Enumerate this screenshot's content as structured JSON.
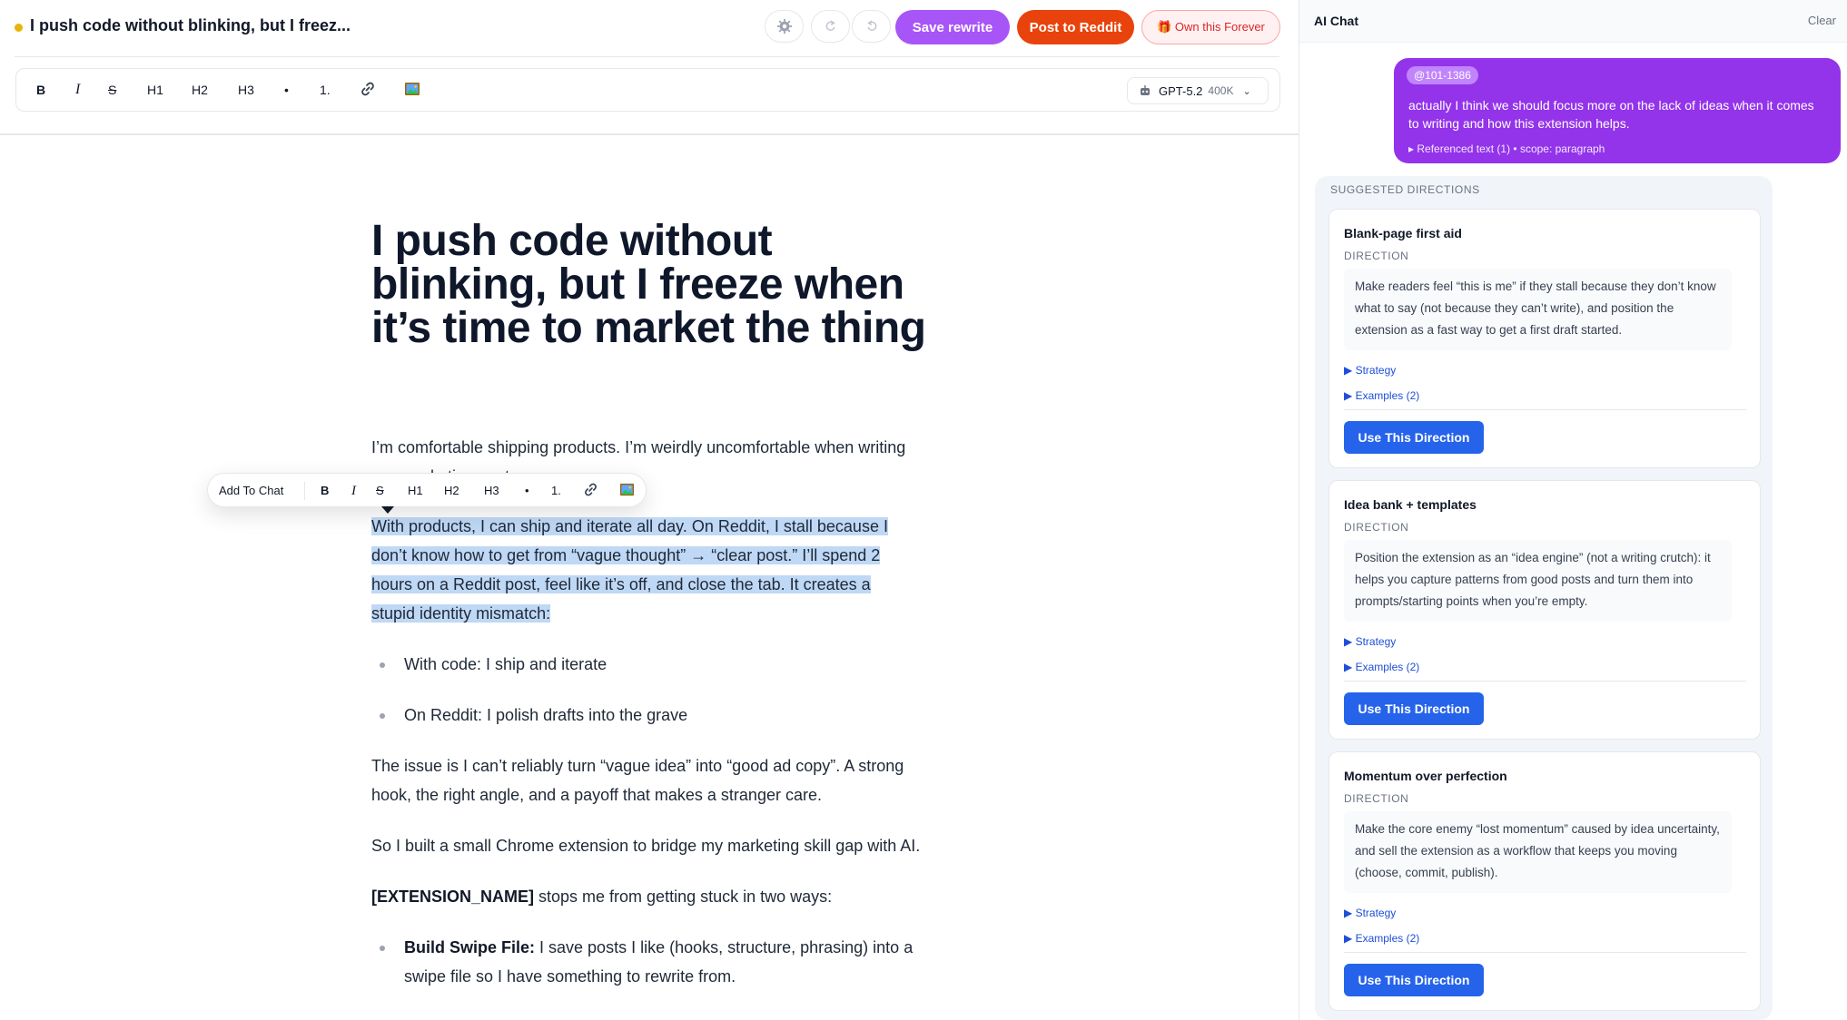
{
  "header": {
    "doc_title": "I push code without blinking, but I freez...",
    "status_color": "#eab308",
    "save_label": "Save rewrite",
    "post_label": "Post to Reddit",
    "own_label": "🎁 Own this Forever"
  },
  "toolbar": {
    "bold": "B",
    "italic": "I",
    "strike": "S",
    "h1": "H1",
    "h2": "H2",
    "h3": "H3",
    "bullet": "•",
    "ordered": "1.",
    "model_name": "GPT-5.2",
    "model_tokens": "400K"
  },
  "floating_toolbar": {
    "add_to_chat": "Add To Chat",
    "bold": "B",
    "italic": "I",
    "strike": "S",
    "h1": "H1",
    "h2": "H2",
    "h3": "H3",
    "bullet": "•",
    "ordered": "1."
  },
  "document": {
    "title": "I push code without blinking, but I freeze when it’s time to market the thing",
    "para1": "I’m comfortable shipping products. I’m weirdly uncomfortable when writing any marketing posts.",
    "para2_selected": "With products, I can ship and iterate all day. On Reddit, I stall because I don’t know how to get from “vague thought” → “clear post.” I’ll spend 2 hours on a Reddit post, feel like it’s off, and close the tab. It creates a stupid identity mismatch:",
    "list1": [
      "With code: I ship and iterate",
      "On Reddit: I polish drafts into the grave"
    ],
    "para3": "The issue is I can’t reliably turn “vague idea” into “good ad copy”. A strong hook, the right angle, and a payoff that makes a stranger care.",
    "para4": "So I built a small Chrome extension to bridge my marketing skill gap with AI.",
    "para5_bold": "[EXTENSION_NAME]",
    "para5_rest": " stops me from getting stuck in two ways:",
    "list2_bold": "Build Swipe File:",
    "list2_rest": " I save posts I like (hooks, structure, phrasing) into a swipe file so I have something to rewrite from."
  },
  "chat": {
    "title": "AI Chat",
    "clear_label": "Clear",
    "user_message": {
      "tag": "@101-1386",
      "text": "actually I think we should focus more on the lack of ideas when it comes to writing and how this extension helps.",
      "reference": "▸ Referenced text (1) • scope: paragraph"
    },
    "suggestions_header": "SUGGESTED DIRECTIONS",
    "cards": [
      {
        "title": "Blank-page first aid",
        "label": "DIRECTION",
        "body": "Make readers feel “this is me” if they stall because they don’t know what to say (not because they can’t write), and position the extension as a fast way to get a first draft started.",
        "strategy": "▶ Strategy",
        "examples": "▶ Examples (2)",
        "button": "Use This Direction"
      },
      {
        "title": "Idea bank + templates",
        "label": "DIRECTION",
        "body": "Position the extension as an “idea engine” (not a writing crutch): it helps you capture patterns from good posts and turn them into prompts/starting points when you’re empty.",
        "strategy": "▶ Strategy",
        "examples": "▶ Examples (2)",
        "button": "Use This Direction"
      },
      {
        "title": "Momentum over perfection",
        "label": "DIRECTION",
        "body": "Make the core enemy “lost momentum” caused by idea uncertainty, and sell the extension as a workflow that keeps you moving (choose, commit, publish).",
        "strategy": "▶ Strategy",
        "examples": "▶ Examples (2)",
        "button": "Use This Direction"
      }
    ]
  },
  "colors": {
    "accent_purple": "#a855f7",
    "reddit_orange": "#e8430c",
    "primary_blue": "#2563eb",
    "selection": "#bfd8f5"
  },
  "icons": {
    "theme": "gear-icon",
    "undo": "undo-icon",
    "redo": "redo-icon",
    "link": "link-icon",
    "image": "image-icon",
    "model": "robot-icon"
  }
}
